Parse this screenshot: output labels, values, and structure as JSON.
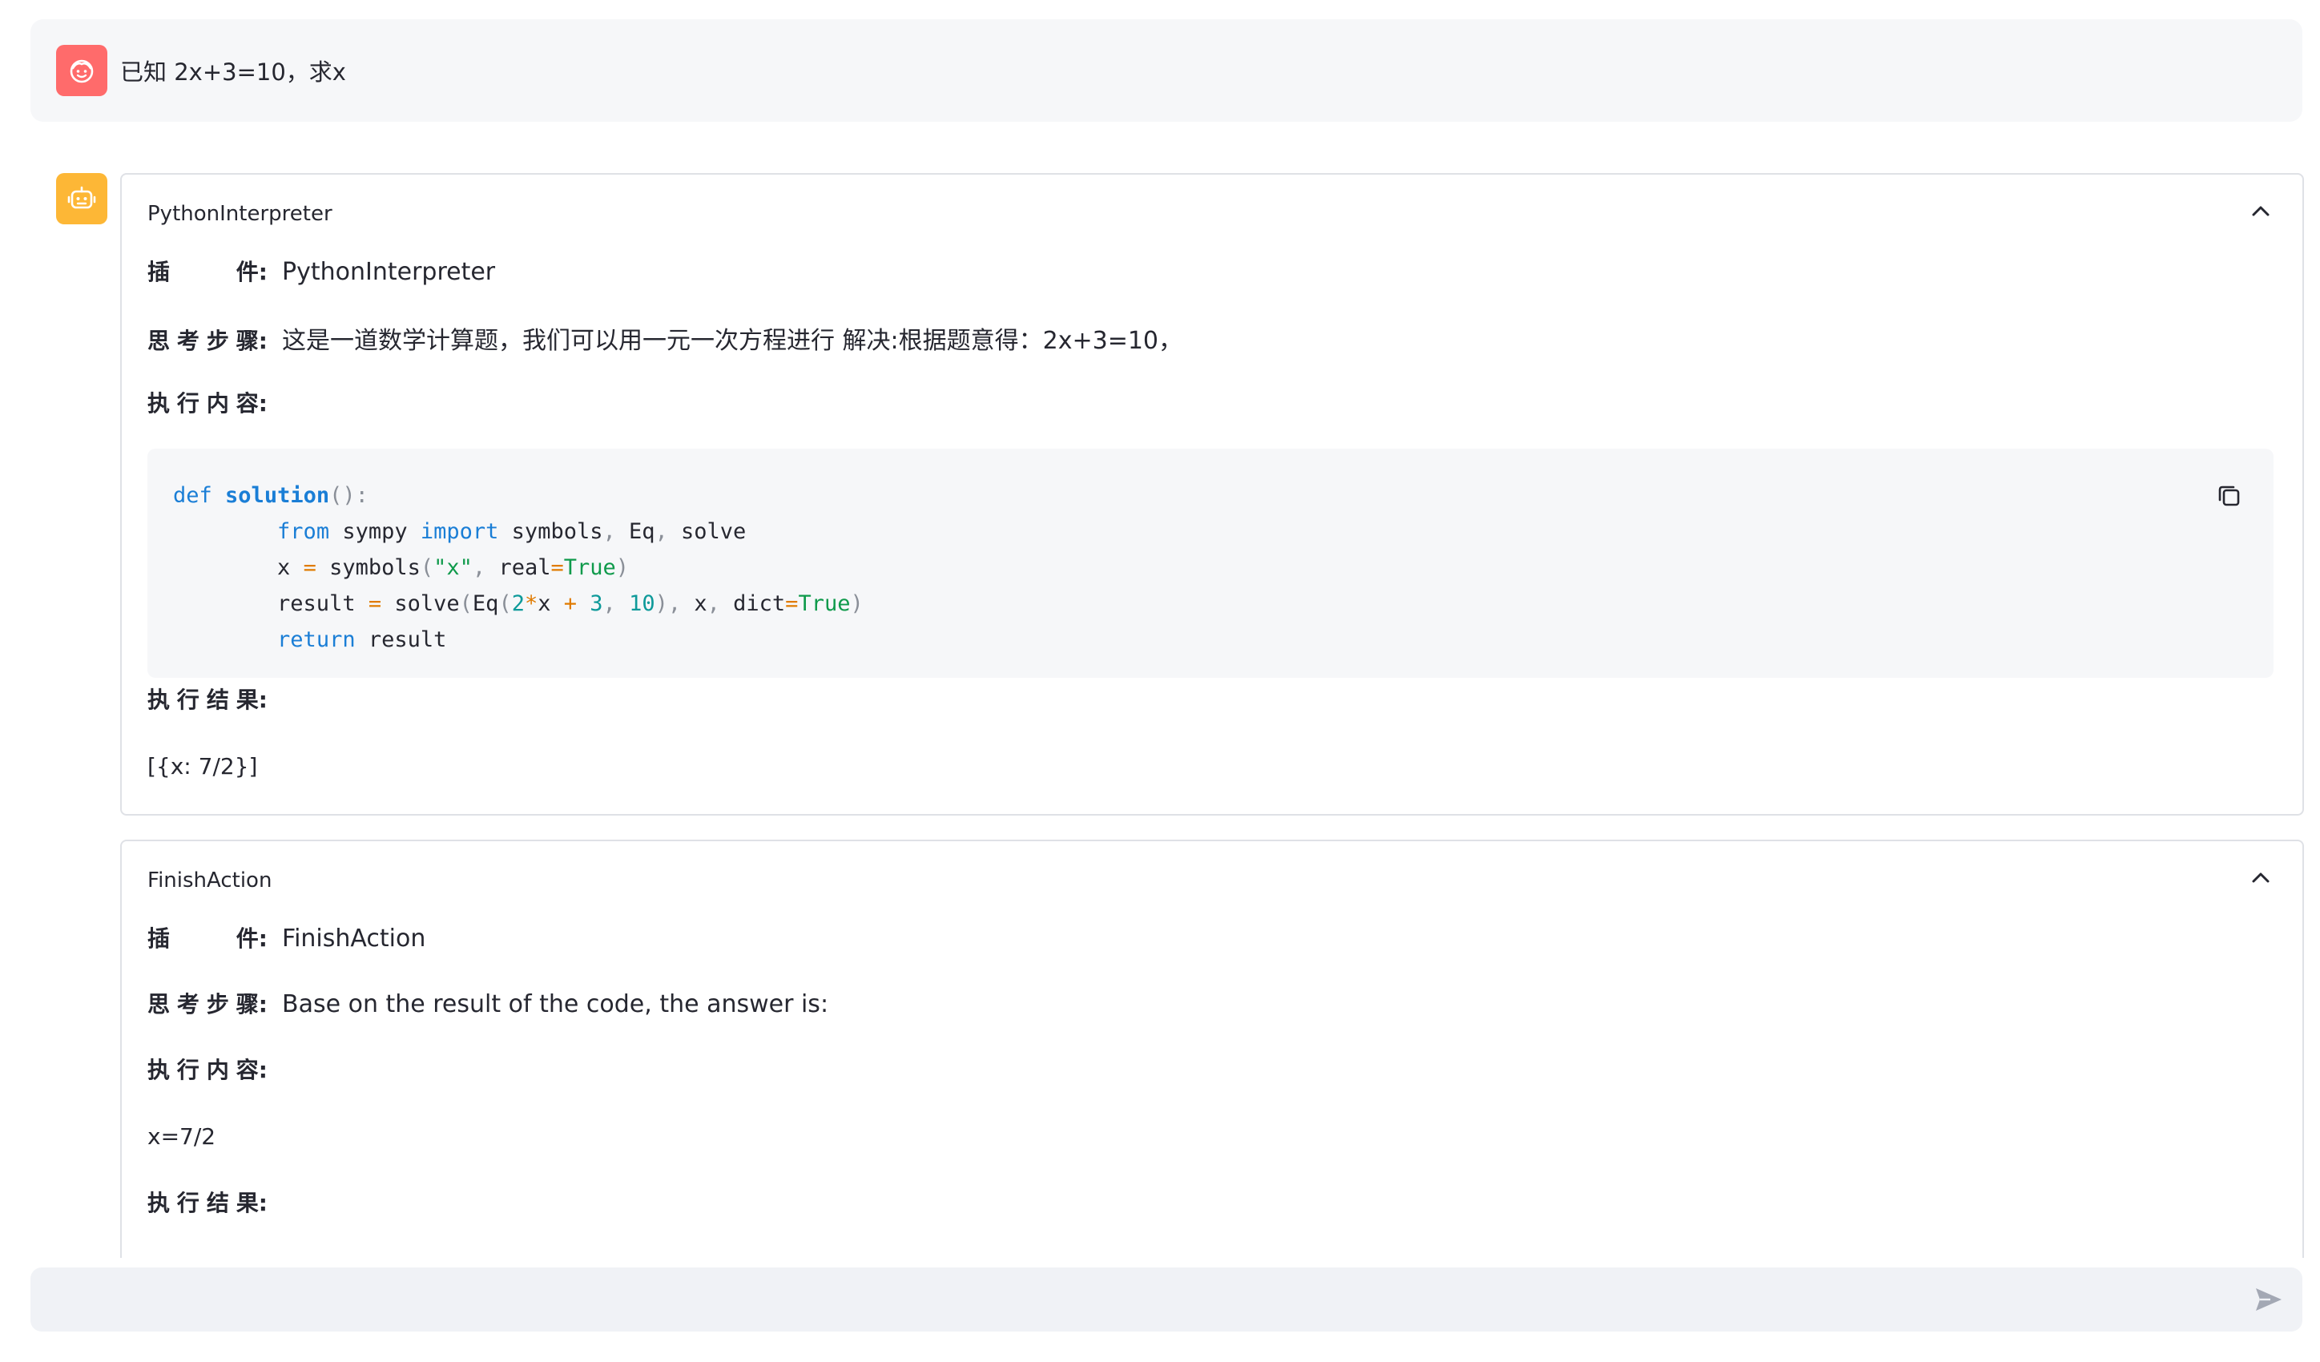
{
  "user_message": {
    "text": "已知 2x+3=10，求x"
  },
  "steps": [
    {
      "title": "PythonInterpreter",
      "plugin_label": [
        "插",
        "件:"
      ],
      "plugin_value": "PythonInterpreter",
      "thought_label": [
        "思",
        "考",
        "步",
        "骤:"
      ],
      "thought_value": "这是一道数学计算题，我们可以用一元一次方程进行 解决:根据题意得：2x+3=10，",
      "action_label": [
        "执",
        "行",
        "内",
        "容:"
      ],
      "code_lines": [
        "def solution():",
        "        from sympy import symbols, Eq, solve",
        "        x = symbols(\"x\", real=True)",
        "        result = solve(Eq(2*x + 3, 10), x, dict=True)",
        "        return result"
      ],
      "result_label": [
        "执",
        "行",
        "结",
        "果:"
      ],
      "result_value": "[{x: 7/2}]"
    },
    {
      "title": "FinishAction",
      "plugin_label": [
        "插",
        "件:"
      ],
      "plugin_value": "FinishAction",
      "thought_label": [
        "思",
        "考",
        "步",
        "骤:"
      ],
      "thought_value": "Base on the result of the code, the answer is:",
      "action_label": [
        "执",
        "行",
        "内",
        "容:"
      ],
      "action_value": "x=7/2",
      "result_label": [
        "执",
        "行",
        "结",
        "果:"
      ]
    }
  ],
  "chat_input": {
    "placeholder": ""
  },
  "icons": {
    "user_avatar": "user-face-icon",
    "bot_avatar": "robot-icon",
    "collapse": "chevron-up-icon",
    "copy": "copy-icon",
    "send": "send-icon"
  },
  "colors": {
    "user_avatar_bg": "#ff6b6b",
    "bot_avatar_bg": "#fdb736",
    "keyword": "#1a7ed6",
    "string": "#0f9a4b",
    "number": "#0e9a9a"
  }
}
